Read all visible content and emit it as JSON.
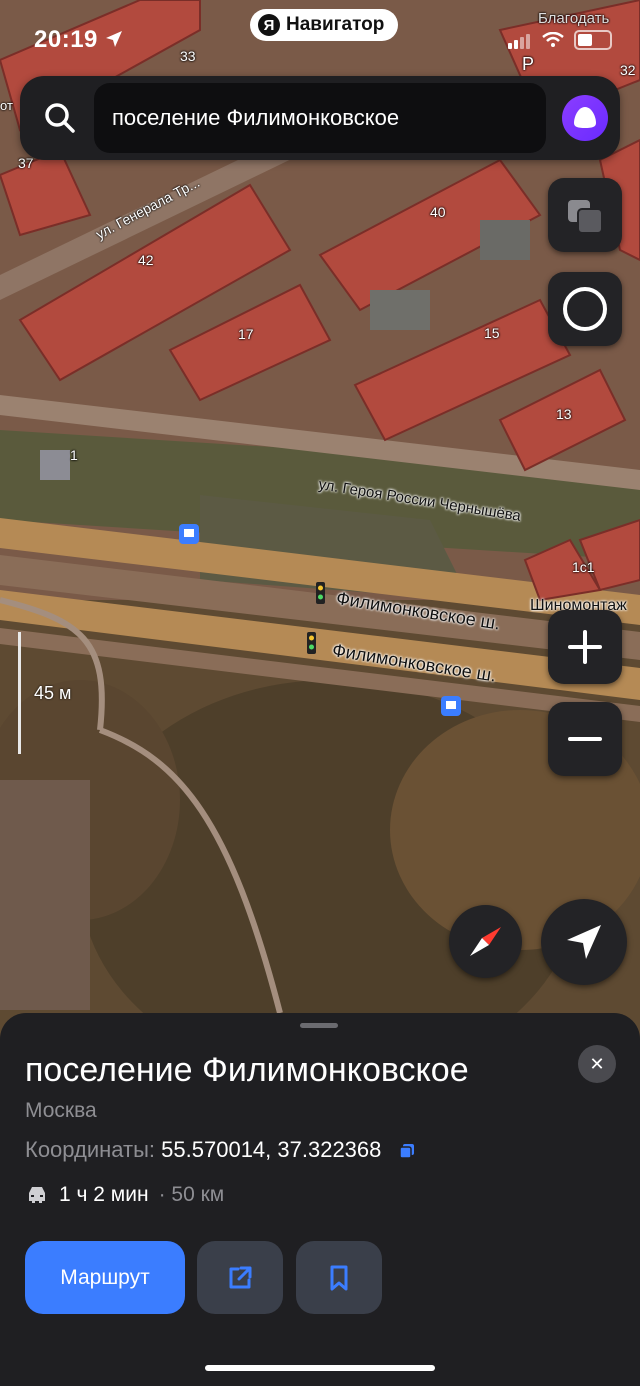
{
  "status": {
    "time": "20:19",
    "app_name": "Навигатор",
    "top_right_text": "Благодать"
  },
  "search": {
    "value": "поселение Филимонковское",
    "icon": "search-icon"
  },
  "map": {
    "labels": {
      "b33": "33",
      "b32": "32",
      "b37": "37",
      "b40": "40",
      "b42": "42",
      "b17": "17",
      "b15": "15",
      "b13": "13",
      "b1": "1",
      "b1c1": "1с1",
      "p": "Р",
      "ot": "от"
    },
    "streets": {
      "generala": "ул. Генерала Тр...",
      "geroya": "ул. Героя России Чернышёва",
      "filimonk1": "Филимонковское ш.",
      "filimonk2": "Филимонковское ш."
    },
    "poi": {
      "tire": "Шиномонтаж"
    },
    "scale": "45 м"
  },
  "card": {
    "title": "поселение Филимонковское",
    "subtitle": "Москва",
    "coords_label": "Координаты:",
    "coords_value": "55.570014, 37.322368",
    "duration": "1 ч 2 мин",
    "distance": "· 50 км",
    "route_button": "Маршрут"
  },
  "colors": {
    "accent": "#3b7dff",
    "panel": "#1f1f22",
    "alice": "#7a35ff"
  }
}
